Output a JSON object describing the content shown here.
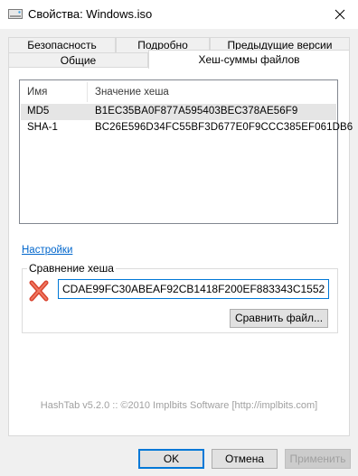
{
  "window": {
    "title": "Свойства: Windows.iso",
    "close_icon": "close-icon"
  },
  "tabs": {
    "row1": [
      {
        "label": "Безопасность"
      },
      {
        "label": "Подробно"
      },
      {
        "label": "Предыдущие версии"
      }
    ],
    "row2": [
      {
        "label": "Общие"
      },
      {
        "label": "Хеш-суммы файлов",
        "active": true
      }
    ]
  },
  "hash_list": {
    "columns": [
      "Имя",
      "Значение хеша"
    ],
    "rows": [
      {
        "name": "MD5",
        "value": "B1EC35BA0F877A595403BEC378AE56F9",
        "selected": true
      },
      {
        "name": "SHA-1",
        "value": "BC26E596D34FC55BF3D677E0F9CCC385EF061DB6",
        "selected": false
      }
    ]
  },
  "settings_link": "Настройки",
  "compare": {
    "title": "Сравнение хеша",
    "status_icon": "red-x-icon",
    "input_value": "CDAE99FC30ABEAF92CB1418F200EF883343C1552",
    "compare_file_button": "Сравнить файл..."
  },
  "footer": "HashTab v5.2.0 :: ©2010 Implbits Software [http://implbits.com]",
  "buttons": {
    "ok": "OK",
    "cancel": "Отмена",
    "apply": "Применить"
  },
  "colors": {
    "accent": "#0078d7",
    "link": "#0066cc",
    "error_red": "#d9432f"
  }
}
